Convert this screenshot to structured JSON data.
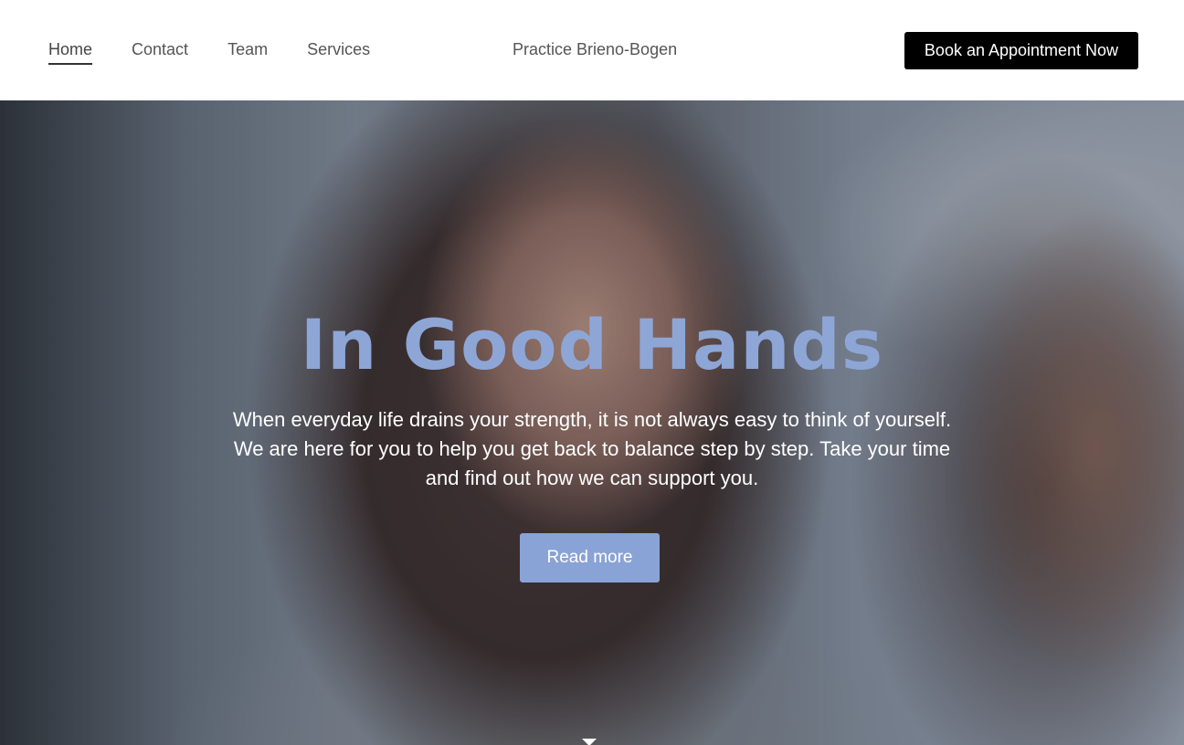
{
  "nav": {
    "items": [
      {
        "label": "Home",
        "active": true
      },
      {
        "label": "Contact",
        "active": false
      },
      {
        "label": "Team",
        "active": false
      },
      {
        "label": "Services",
        "active": false
      }
    ]
  },
  "header": {
    "brand": "Practice Brieno-Bogen",
    "cta_label": "Book an Appointment Now"
  },
  "hero": {
    "title": "In Good Hands",
    "body": "When everyday life drains your strength, it is not always easy to think of yourself. We are here for you to help you get back to balance step by step. Take your time and find out how we can support you.",
    "button_label": "Read more",
    "scroll_icon": "chevron-down-icon"
  },
  "colors": {
    "accent": "#8aa3d6",
    "title": "#8ea6d6",
    "cta_bg": "#000000"
  }
}
